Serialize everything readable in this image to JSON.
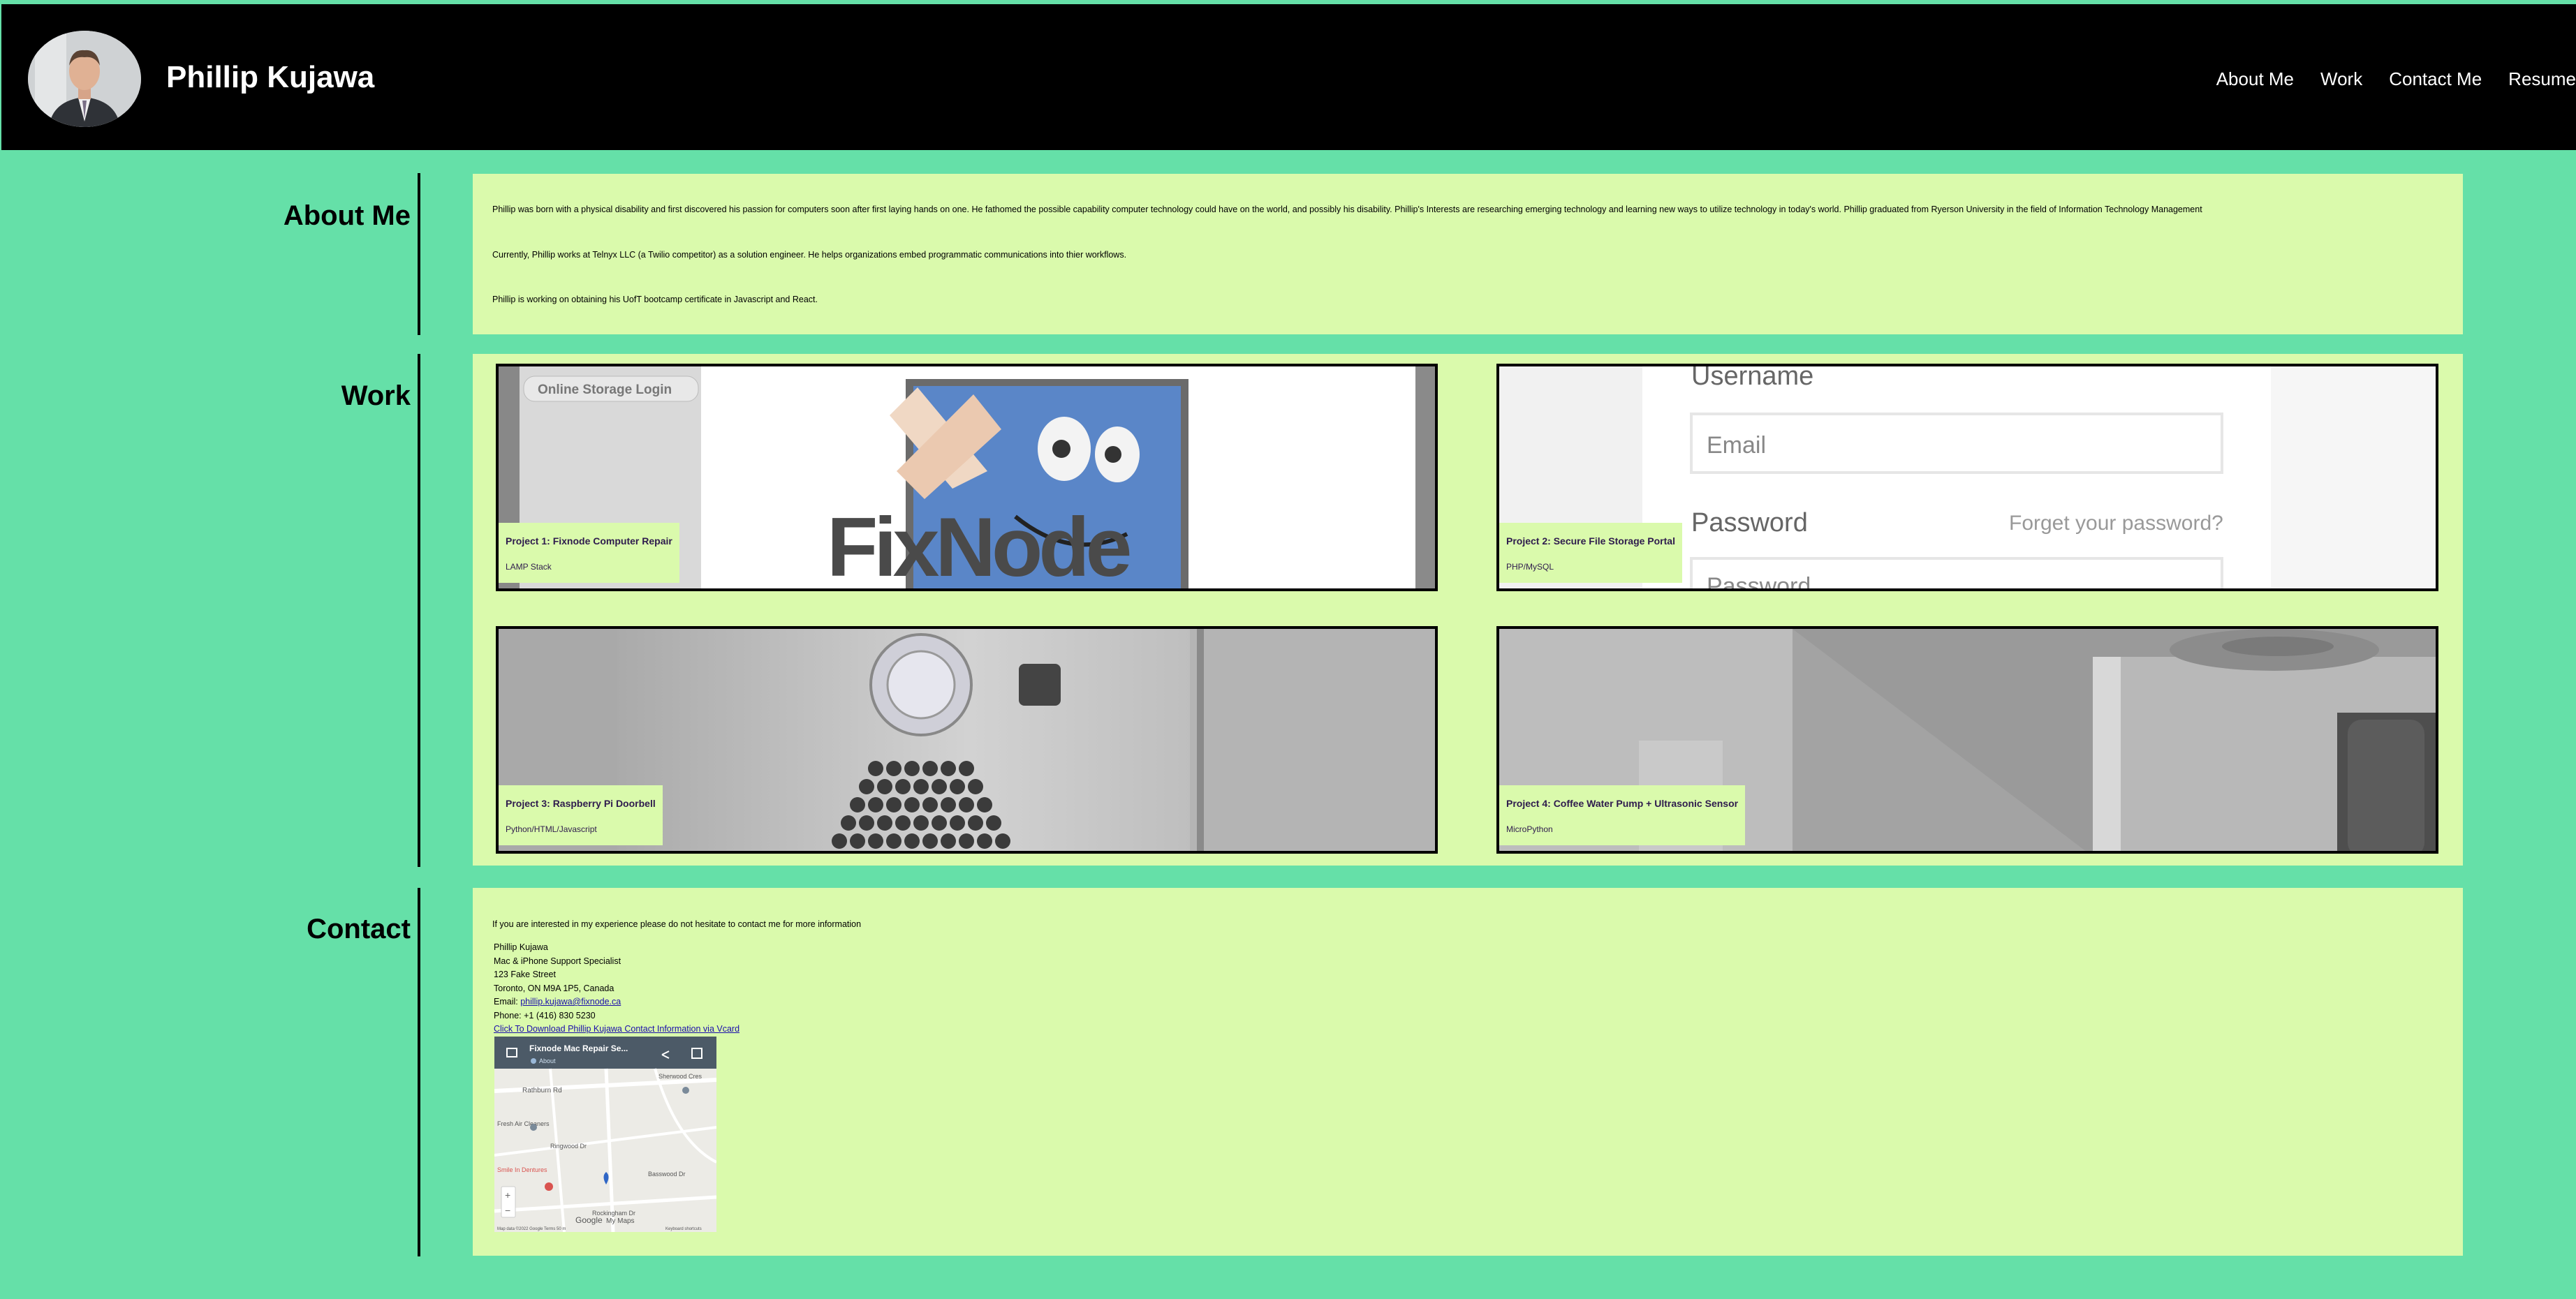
{
  "header": {
    "name": "Phillip Kujawa",
    "nav": [
      "About Me",
      "Work",
      "Contact Me",
      "Resume"
    ]
  },
  "sections": {
    "about_title": "About Me",
    "work_title": "Work",
    "contact_title": "Contact"
  },
  "about": {
    "p1": "Phillip was born with a physical disability and first discovered his passion for computers soon after first laying hands on one. He fathomed the possible capability computer technology could have on the world, and possibly his disability. Phillip's Interests are researching emerging technology and learning new ways to utilize technology in today's world. Phillip graduated from Ryerson University in the field of Information Technology Management",
    "p2": "Currently, Phillip works at Telnyx LLC (a Twilio competitor) as a solution engineer. He helps organizations embed programmatic communications into thier workflows.",
    "p3": "Phillip is working on obtaining his UofT bootcamp certificate in Javascript and React."
  },
  "projects": [
    {
      "title": "Project 1: Fixnode Computer Repair",
      "stack": "LAMP Stack",
      "image_text": "FixNode",
      "image_tab": "Online Storage Login"
    },
    {
      "title": "Project 2: Secure File Storage Portal",
      "stack": "PHP/MySQL",
      "image_username": "Username",
      "image_email": "Email",
      "image_password": "Password",
      "image_forgot": "Forget your password?",
      "image_password2": "Password"
    },
    {
      "title": "Project 3: Raspberry Pi Doorbell",
      "stack": "Python/HTML/Javascript"
    },
    {
      "title": "Project 4: Coffee Water Pump + Ultrasonic Sensor",
      "stack": "MicroPython"
    }
  ],
  "contact": {
    "intro": "If you are interested in my experience please do not hesitate to contact me for more information",
    "name": "Phillip Kujawa",
    "role": "Mac & iPhone Support Specialist",
    "street": "123 Fake Street",
    "city": "Toronto, ON M9A 1P5, Canada",
    "email_label": "Email: ",
    "email": "phillip.kujawa@fixnode.ca",
    "phone": "Phone: +1 (416) 830 5230",
    "vcard": "Click To Download Phillip Kujawa Contact Information via Vcard"
  },
  "map": {
    "title": "Fixnode Mac Repair Se...",
    "about": "About",
    "streets": [
      "Rathburn Rd",
      "Sherwood Cres",
      "Fresh Air Cleaners",
      "Ringwood Dr",
      "Smile In Dentures",
      "Rockingham Dr",
      "Basswood Dr"
    ],
    "footer": "Map data ©2022 Google   Terms   50 m",
    "shortcuts": "Keyboard shortcuts",
    "zoom_in": "+",
    "zoom_out": "−",
    "google": "Google",
    "myplace": "My Maps"
  },
  "colors": {
    "page_bg": "#65e0a8",
    "panel_bg": "#dafaac",
    "header_bg": "#000000",
    "label_text": "#2e1b4d"
  }
}
